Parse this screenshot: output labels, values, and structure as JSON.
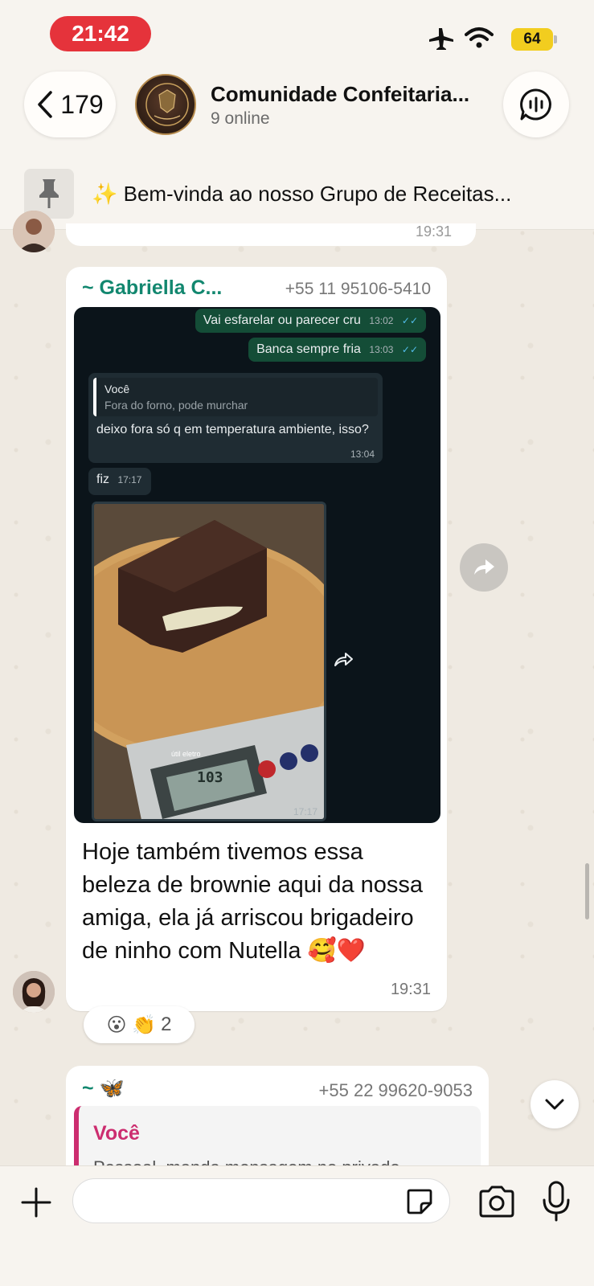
{
  "status_bar": {
    "time": "21:42",
    "battery": "64",
    "icons": [
      "airplane-icon",
      "wifi-icon",
      "battery-icon"
    ]
  },
  "header": {
    "back_count": "179",
    "group_name": "Comunidade Confeitaria...",
    "online": "9 online",
    "avatar_text_top": "COMUNIDADE CONFEITARIA",
    "avatar_text_bottom": "LUCRATIVA"
  },
  "pinned": {
    "text": "✨ Bem-vinda ao nosso Grupo de Receitas..."
  },
  "previous_message": {
    "time": "19:31"
  },
  "message": {
    "sender_name": "~ Gabriella C...",
    "sender_phone": "+55 11 95106-5410",
    "screenshot": {
      "out1": "Vai esfarelar ou parecer cru",
      "out1_time": "13:02",
      "out2": "Banca sempre fria",
      "out2_time": "13:03",
      "quote_name": "Você",
      "quote_text": "Fora do forno, pode murchar",
      "reply_text": "deixo fora só q em temperatura ambiente, isso?",
      "reply_time": "13:04",
      "fiz": "fiz",
      "fiz_time": "17:17",
      "photo_time": "17:17",
      "scale_display": "103",
      "scale_brand": "útil eletro"
    },
    "text": "Hoje também tivemos essa beleza de brownie aqui da nossa amiga, ela já arriscou brigadeiro de ninho com Nutella 🥰❤️",
    "time": "19:31",
    "reactions": "😮 👏",
    "reaction_count": "2"
  },
  "next_message": {
    "sender_name": "~ 🦋",
    "sender_phone": "+55 22 99620-9053",
    "reply_name": "Você",
    "reply_text": "Pessoal, manda mensagem no privado"
  },
  "composer": {
    "placeholder": "",
    "value": ""
  }
}
